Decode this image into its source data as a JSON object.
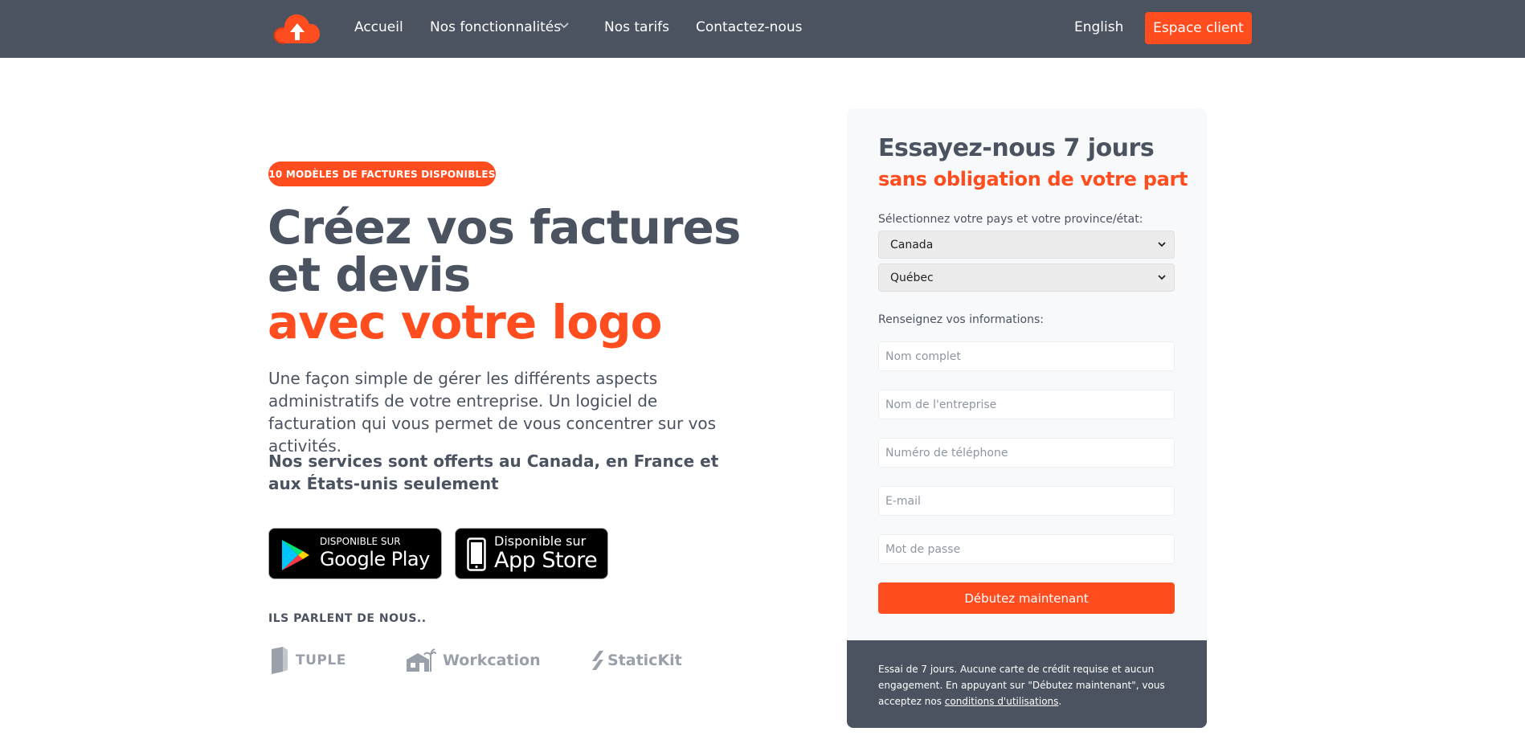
{
  "nav": {
    "links": [
      "Accueil",
      "Nos fonctionnalités",
      "Nos tarifs",
      "Contactez-nous"
    ],
    "language": "English",
    "client_button": "Espace client"
  },
  "colors": {
    "accent": "#ff4d1f",
    "dark": "#4b5361",
    "card_bg": "#f8f9fa"
  },
  "hero": {
    "badge": "10 MODÈLES DE FACTURES DISPONIBLES",
    "title_line1": "Créez vos factures",
    "title_line2": "et devis",
    "title_accent": "avec votre logo",
    "description": "Une façon simple de gérer les différents aspects administratifs de votre entreprise. Un logiciel de facturation qui vous permet de vous concentrer sur vos activités.",
    "services": "Nos services sont offerts au Canada, en France et aux États-unis seulement"
  },
  "stores": {
    "google_small": "DISPONIBLE SUR",
    "google_big": "Google Play",
    "apple_small": "Disponible sur",
    "apple_big": "App Store"
  },
  "press": {
    "label": "ILS PARLENT DE NOUS..",
    "logos": [
      "TUPLE",
      "Workcation",
      "StaticKit"
    ]
  },
  "form": {
    "title": "Essayez-nous 7 jours",
    "subtitle": "sans obligation de votre part",
    "country_label": "Sélectionnez votre pays et votre province/état:",
    "country_value": "Canada",
    "province_value": "Québec",
    "info_label": "Renseignez vos informations:",
    "placeholders": {
      "name": "Nom complet",
      "company": "Nom de l'entreprise",
      "phone": "Numéro de téléphone",
      "email": "E-mail",
      "password": "Mot de passe"
    },
    "submit": "Débutez maintenant",
    "footer_text": "Essai de 7 jours. Aucune carte de crédit requise et aucun engagement. En appuyant sur \"Débutez maintenant\", vous acceptez nos ",
    "footer_link": "conditions d'utilisations",
    "footer_end": "."
  }
}
